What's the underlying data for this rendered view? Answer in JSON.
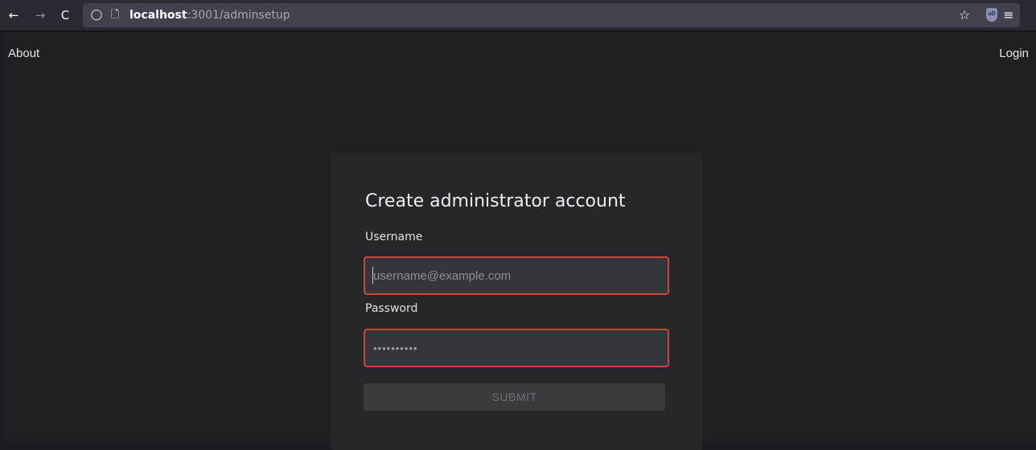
{
  "browser": {
    "back_icon": "←",
    "forward_icon": "→",
    "reload_icon": "C",
    "shield_icon": "◯",
    "page_icon": "🗋",
    "url_host": "localhost",
    "url_rest": ":3001/adminsetup",
    "star_icon": "☆",
    "ublock_label": "uD",
    "menu_icon": "≡"
  },
  "nav": {
    "about": "About",
    "login": "Login"
  },
  "form": {
    "title": "Create administrator account",
    "username_label": "Username",
    "username_placeholder": "username@example.com",
    "username_value": "",
    "password_label": "Password",
    "password_value": "••••••••••",
    "submit_label": "SUBMIT"
  },
  "colors": {
    "error_border": "#c9473a",
    "page_bg": "#1f2023",
    "card_bg": "#26272b"
  }
}
